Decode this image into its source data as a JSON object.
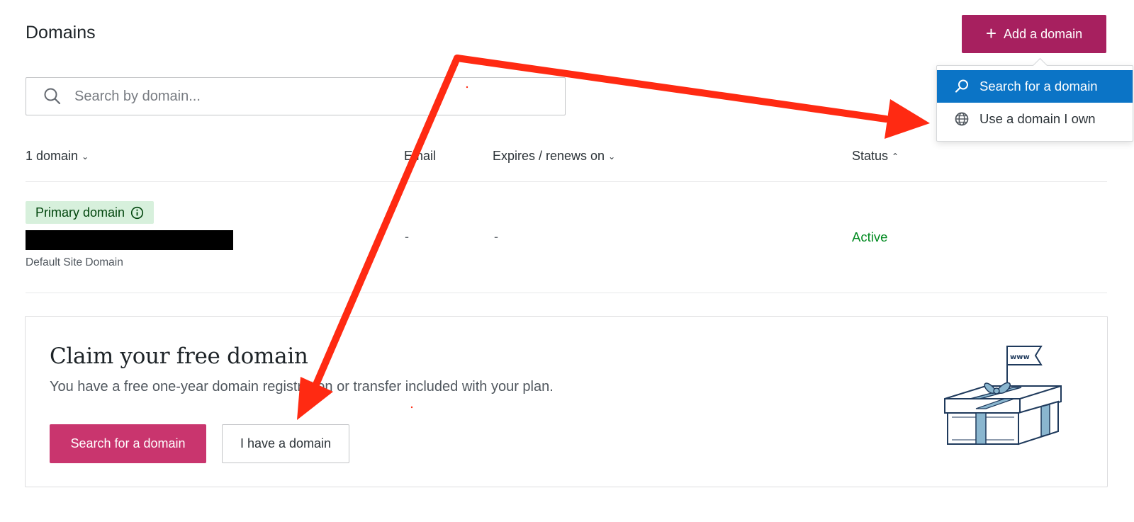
{
  "header": {
    "title": "Domains",
    "add_button_label": "Add a domain"
  },
  "add_menu": {
    "items": [
      {
        "label": "Search for a domain",
        "icon": "search-icon",
        "highlighted": true
      },
      {
        "label": "Use a domain I own",
        "icon": "globe-icon",
        "highlighted": false
      }
    ]
  },
  "search": {
    "placeholder": "Search by domain..."
  },
  "table": {
    "columns": {
      "count": "1 domain",
      "email": "Email",
      "expires": "Expires / renews on",
      "status": "Status"
    },
    "rows": [
      {
        "badge": "Primary domain",
        "domain_subtitle": "Default Site Domain",
        "email": "-",
        "expires": "-",
        "status": "Active"
      }
    ]
  },
  "claim": {
    "title": "Claim your free domain",
    "description": "You have a free one-year domain registration or transfer included with your plan.",
    "primary_button": "Search for a domain",
    "secondary_button": "I have a domain",
    "illustration_text": "www"
  },
  "colors": {
    "brand_pink": "#a7205f",
    "primary_button": "#c9356e",
    "menu_highlight": "#0b74c6",
    "status_active": "#008a20",
    "badge_bg": "#d7f0dc",
    "annotation_arrow": "#ff2a12"
  }
}
